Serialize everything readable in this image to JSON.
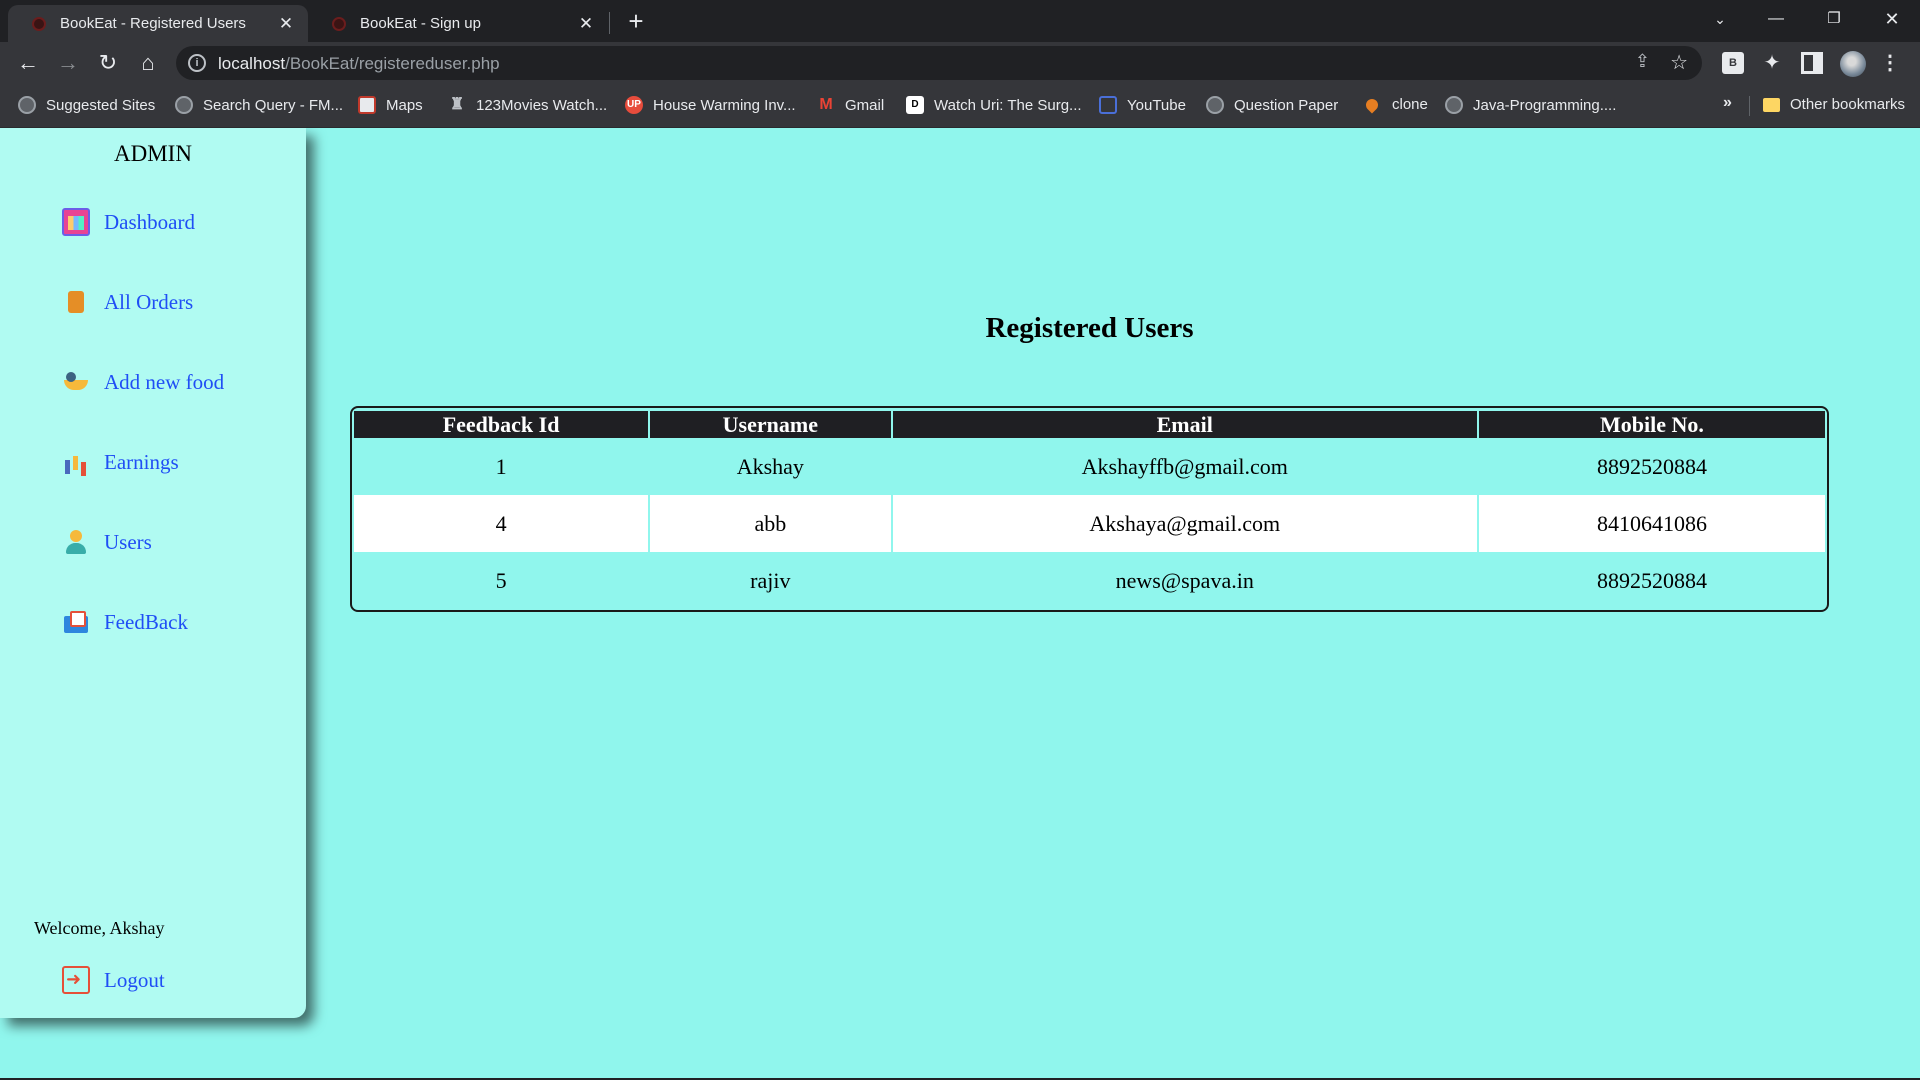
{
  "browser": {
    "tabs": [
      {
        "title": "BookEat - Registered Users",
        "active": true
      },
      {
        "title": "BookEat - Sign up",
        "active": false
      }
    ],
    "url_host": "localhost",
    "url_path": "/BookEat/registereduser.php",
    "bookmarks": [
      {
        "label": "Suggested Sites",
        "icon": "globe-icon"
      },
      {
        "label": "Search Query - FM...",
        "icon": "globe-icon"
      },
      {
        "label": "Maps",
        "icon": "maps-icon"
      },
      {
        "label": "123Movies Watch...",
        "icon": "chess-icon"
      },
      {
        "label": "House Warming Inv...",
        "icon": "up-icon"
      },
      {
        "label": "Gmail",
        "icon": "gmail-icon"
      },
      {
        "label": "Watch Uri: The Surg...",
        "icon": "d-icon"
      },
      {
        "label": "YouTube",
        "icon": "youtube-icon"
      },
      {
        "label": "Question Paper",
        "icon": "globe-icon"
      },
      {
        "label": "clone",
        "icon": "pin-icon"
      },
      {
        "label": "Java-Programming....",
        "icon": "globe-icon"
      }
    ],
    "more_bookmarks": "»",
    "other_bookmarks": "Other bookmarks",
    "extension_label": "B"
  },
  "sidebar": {
    "title": "ADMIN",
    "items": [
      {
        "label": "Dashboard",
        "icon": "dashboard-icon"
      },
      {
        "label": "All Orders",
        "icon": "orders-icon"
      },
      {
        "label": "Add new food",
        "icon": "food-icon"
      },
      {
        "label": "Earnings",
        "icon": "earnings-icon"
      },
      {
        "label": "Users",
        "icon": "users-icon"
      },
      {
        "label": "FeedBack",
        "icon": "feedback-icon"
      }
    ],
    "welcome": "Welcome, Akshay",
    "logout": "Logout"
  },
  "main": {
    "heading": "Registered Users",
    "table": {
      "columns": [
        "Feedback Id",
        "Username",
        "Email",
        "Mobile No."
      ],
      "rows": [
        [
          "1",
          "Akshay",
          "Akshayffb@gmail.com",
          "8892520884"
        ],
        [
          "4",
          "abb",
          "Akshaya@gmail.com",
          "8410641086"
        ],
        [
          "5",
          "rajiv",
          "news@spava.in",
          "8892520884"
        ]
      ]
    }
  },
  "colors": {
    "page_background": "#90f6ed",
    "sidebar_background": "#b0fbf2",
    "link": "#1f4ef5",
    "table_header": "#1f1f23"
  }
}
